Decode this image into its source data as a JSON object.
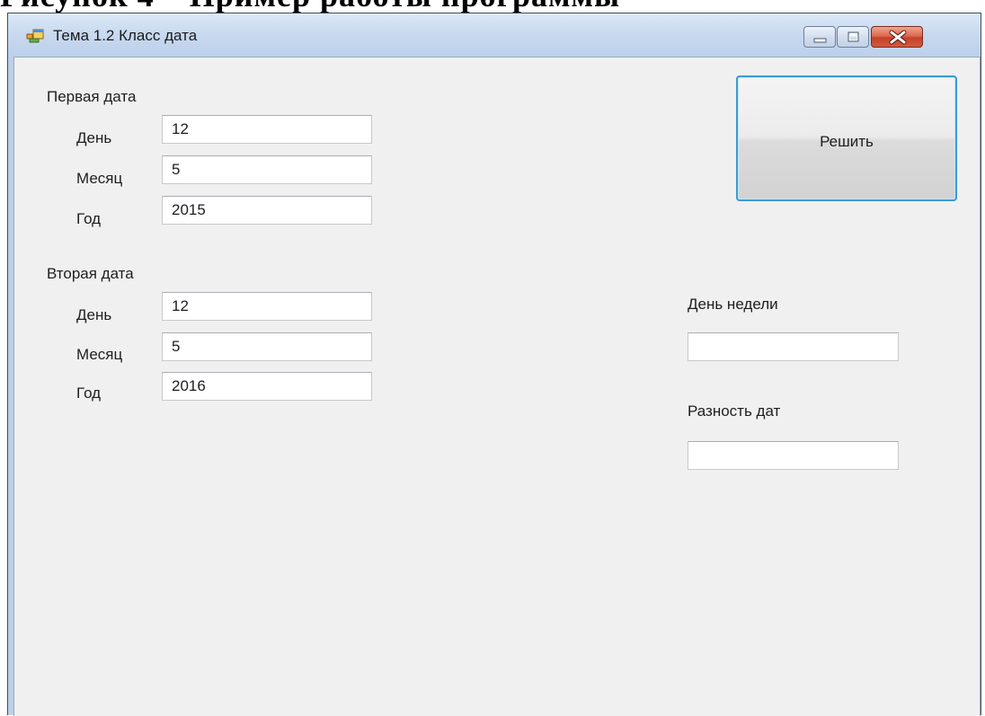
{
  "window": {
    "title": "Тема 1.2 Класс дата"
  },
  "first_date": {
    "heading": "Первая дата",
    "day_label": "День",
    "day_value": "12",
    "month_label": "Месяц",
    "month_value": "5",
    "year_label": "Год",
    "year_value": "2015"
  },
  "second_date": {
    "heading": "Вторая дата",
    "day_label": "День",
    "day_value": "12",
    "month_label": "Месяц",
    "month_value": "5",
    "year_label": "Год",
    "year_value": "2016"
  },
  "actions": {
    "solve_label": "Решить"
  },
  "results": {
    "weekday_label": "День недели",
    "weekday_value": "",
    "difference_label": "Разность дат",
    "difference_value": ""
  },
  "icons": {
    "app": "app-window-icon",
    "minimize": "minimize-icon",
    "maximize": "maximize-icon",
    "close": "close-icon"
  },
  "colors": {
    "titlebar": "#bcd0ea",
    "client_background": "#f0f0f0",
    "close_button": "#c4402a",
    "focus_border": "#3c9ad3"
  }
}
